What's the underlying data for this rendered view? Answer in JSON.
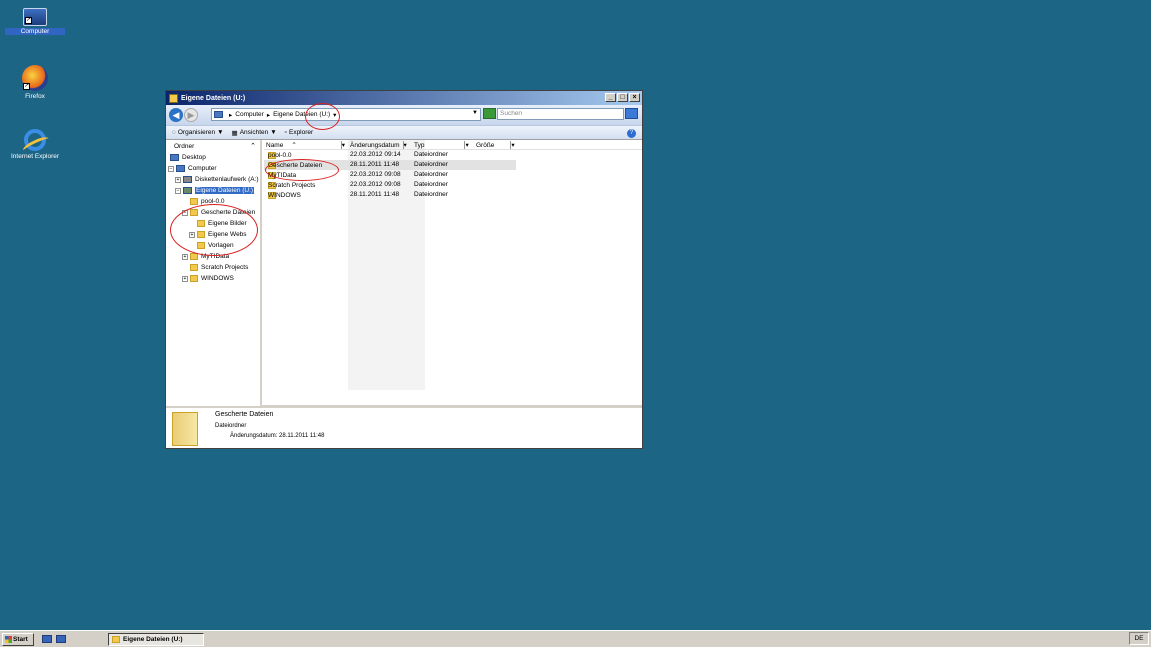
{
  "desktop": {
    "icons": [
      {
        "label": "Computer",
        "icon": "computer-icon"
      },
      {
        "label": "Firefox",
        "icon": "firefox-icon"
      },
      {
        "label": "Internet Explorer",
        "icon": "internet-explorer-icon"
      }
    ]
  },
  "window": {
    "title": "Eigene Dateien (U:)",
    "title_buttons": [
      "_",
      "□",
      "×"
    ],
    "address": {
      "crumbs": [
        "Computer",
        "Eigene Dateien (U:)"
      ],
      "search_placeholder": "Suchen"
    },
    "commands": {
      "organize": "Organisieren",
      "views": "Ansichten",
      "explorer": "Explorer"
    },
    "tree": {
      "header": "Ordner",
      "items": [
        {
          "label": "Desktop"
        },
        {
          "label": "Computer"
        },
        {
          "label": "Diskettenlaufwerk (A:)"
        },
        {
          "label": "Eigene Dateien (U:)"
        },
        {
          "label": "pool-0.0"
        },
        {
          "label": "Gescherte Dateien"
        },
        {
          "label": "Eigene Bilder"
        },
        {
          "label": "Eigene Webs"
        },
        {
          "label": "Vorlagen"
        },
        {
          "label": "MyTIData"
        },
        {
          "label": "Scratch Projects"
        },
        {
          "label": "WINDOWS"
        }
      ]
    },
    "list": {
      "columns": [
        "Name",
        "Änderungsdatum",
        "Typ",
        "Größe"
      ],
      "rows": [
        {
          "name": "pool-0.0",
          "date": "22.03.2012 09:14",
          "type": "Dateiordner"
        },
        {
          "name": "Gescherte Dateien",
          "date": "28.11.2011 11:48",
          "type": "Dateiordner"
        },
        {
          "name": "MyTIData",
          "date": "22.03.2012 09:08",
          "type": "Dateiordner"
        },
        {
          "name": "Scratch Projects",
          "date": "22.03.2012 09:08",
          "type": "Dateiordner"
        },
        {
          "name": "WINDOWS",
          "date": "28.11.2011 11:48",
          "type": "Dateiordner"
        }
      ]
    },
    "details": {
      "name": "Gescherte Dateien",
      "type": "Dateiordner",
      "modified": "Änderungsdatum: 28.11.2011 11:48"
    }
  },
  "taskbar": {
    "start": "Start",
    "task": "Eigene Dateien (U:)",
    "language": "DE"
  },
  "colors": {
    "desktop": "#1d6585",
    "annotation": "#d8201f",
    "selection": "#316ac5"
  }
}
